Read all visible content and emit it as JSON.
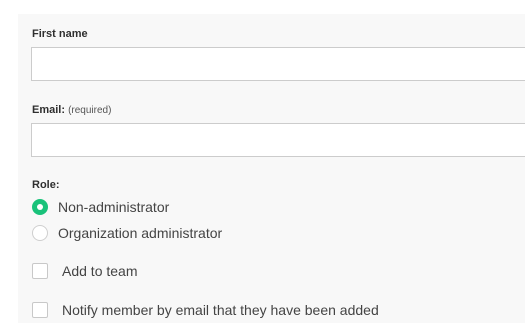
{
  "form": {
    "first_name": {
      "label": "First name",
      "value": "",
      "placeholder": ""
    },
    "email": {
      "label": "Email:",
      "hint": "(required)",
      "value": "",
      "placeholder": ""
    },
    "role": {
      "label": "Role:",
      "options": [
        {
          "label": "Non-administrator",
          "checked": true
        },
        {
          "label": "Organization administrator",
          "checked": false
        }
      ]
    },
    "add_to_team": {
      "label": "Add to team",
      "checked": false
    },
    "notify": {
      "label": "Notify member by email that they have been added",
      "checked": false
    }
  },
  "colors": {
    "accent": "#19c27a",
    "panel_bg": "#f8f8f8",
    "border": "#cccccc"
  }
}
